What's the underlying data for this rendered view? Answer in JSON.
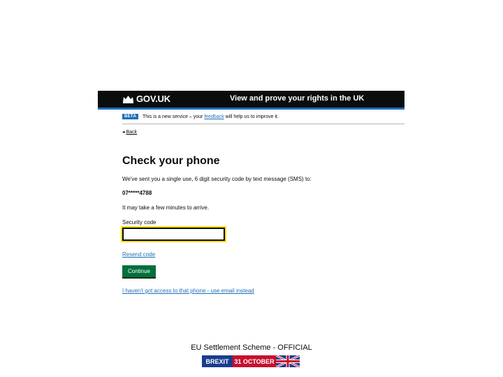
{
  "header": {
    "logo_text": "GOV.UK",
    "service_name": "View and prove your rights in the UK",
    "colors": {
      "header_bg": "#0b0c0c",
      "accent": "#1d70b8"
    }
  },
  "phase_banner": {
    "tag": "BETA",
    "text_before": "This is a new service – your ",
    "link": "feedback",
    "text_after": " will help us to improve it."
  },
  "back_link": {
    "arrow": "◂",
    "label": "Back"
  },
  "page": {
    "title": "Check your phone",
    "intro": "We've sent you a single use, 6 digit security code by text message (SMS) to:",
    "phone_number": "07*****4788",
    "note": "It may take a few minutes to arrive."
  },
  "form": {
    "security_code_label": "Security code",
    "security_code_value": "",
    "resend_link": "Resend code",
    "continue_button": "Continue",
    "alt_link": "I haven't got access to that phone - use email instead",
    "colors": {
      "button": "#00703c",
      "focus": "#ffdd00",
      "link": "#1d70b8"
    }
  },
  "footer": {
    "classification": "EU Settlement Scheme - OFFICIAL",
    "banner_left": "BREXIT",
    "banner_right": "31 OCTOBER",
    "colors": {
      "banner_blue": "#1a3c8f",
      "banner_red": "#c8102e"
    }
  }
}
